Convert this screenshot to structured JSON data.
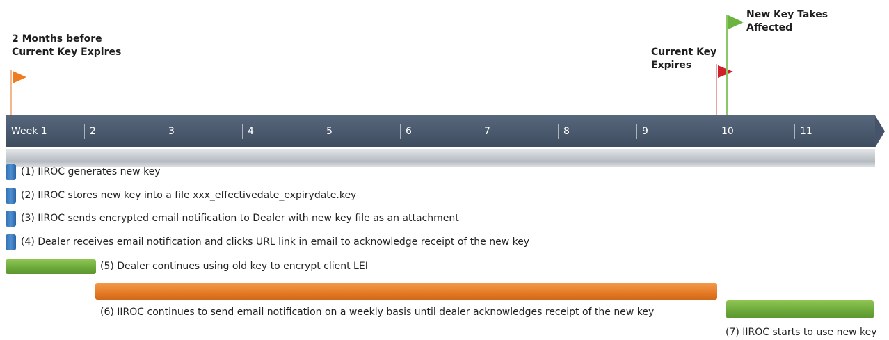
{
  "flags": {
    "start": {
      "label_line1": "2 Months before",
      "label_line2": "Current Key Expires",
      "color": "#f07c22"
    },
    "expire": {
      "label_line1": "Current Key",
      "label_line2": "Expires",
      "color": "#d0202a"
    },
    "new": {
      "label_line1": "New Key Takes",
      "label_line2": "Affected",
      "color": "#6cb33f"
    }
  },
  "timeline": {
    "weeks": [
      "Week 1",
      "2",
      "3",
      "4",
      "5",
      "6",
      "7",
      "8",
      "9",
      "10",
      "11"
    ],
    "bar_color": "#46546a"
  },
  "steps": [
    "(1) IIROC generates new key",
    "(2) IIROC stores new key into a file xxx_effectivedate_expirydate.key",
    "(3) IIROC sends encrypted email notification to Dealer with new key file as an attachment",
    "(4) Dealer receives email notification and clicks URL link in email to acknowledge receipt of the new key",
    "(5) Dealer continues using old key to encrypt client LEI",
    "(6) IIROC continues to send email notification on a weekly basis until dealer acknowledges receipt of the new key",
    "(7) IIROC starts to use new key"
  ]
}
